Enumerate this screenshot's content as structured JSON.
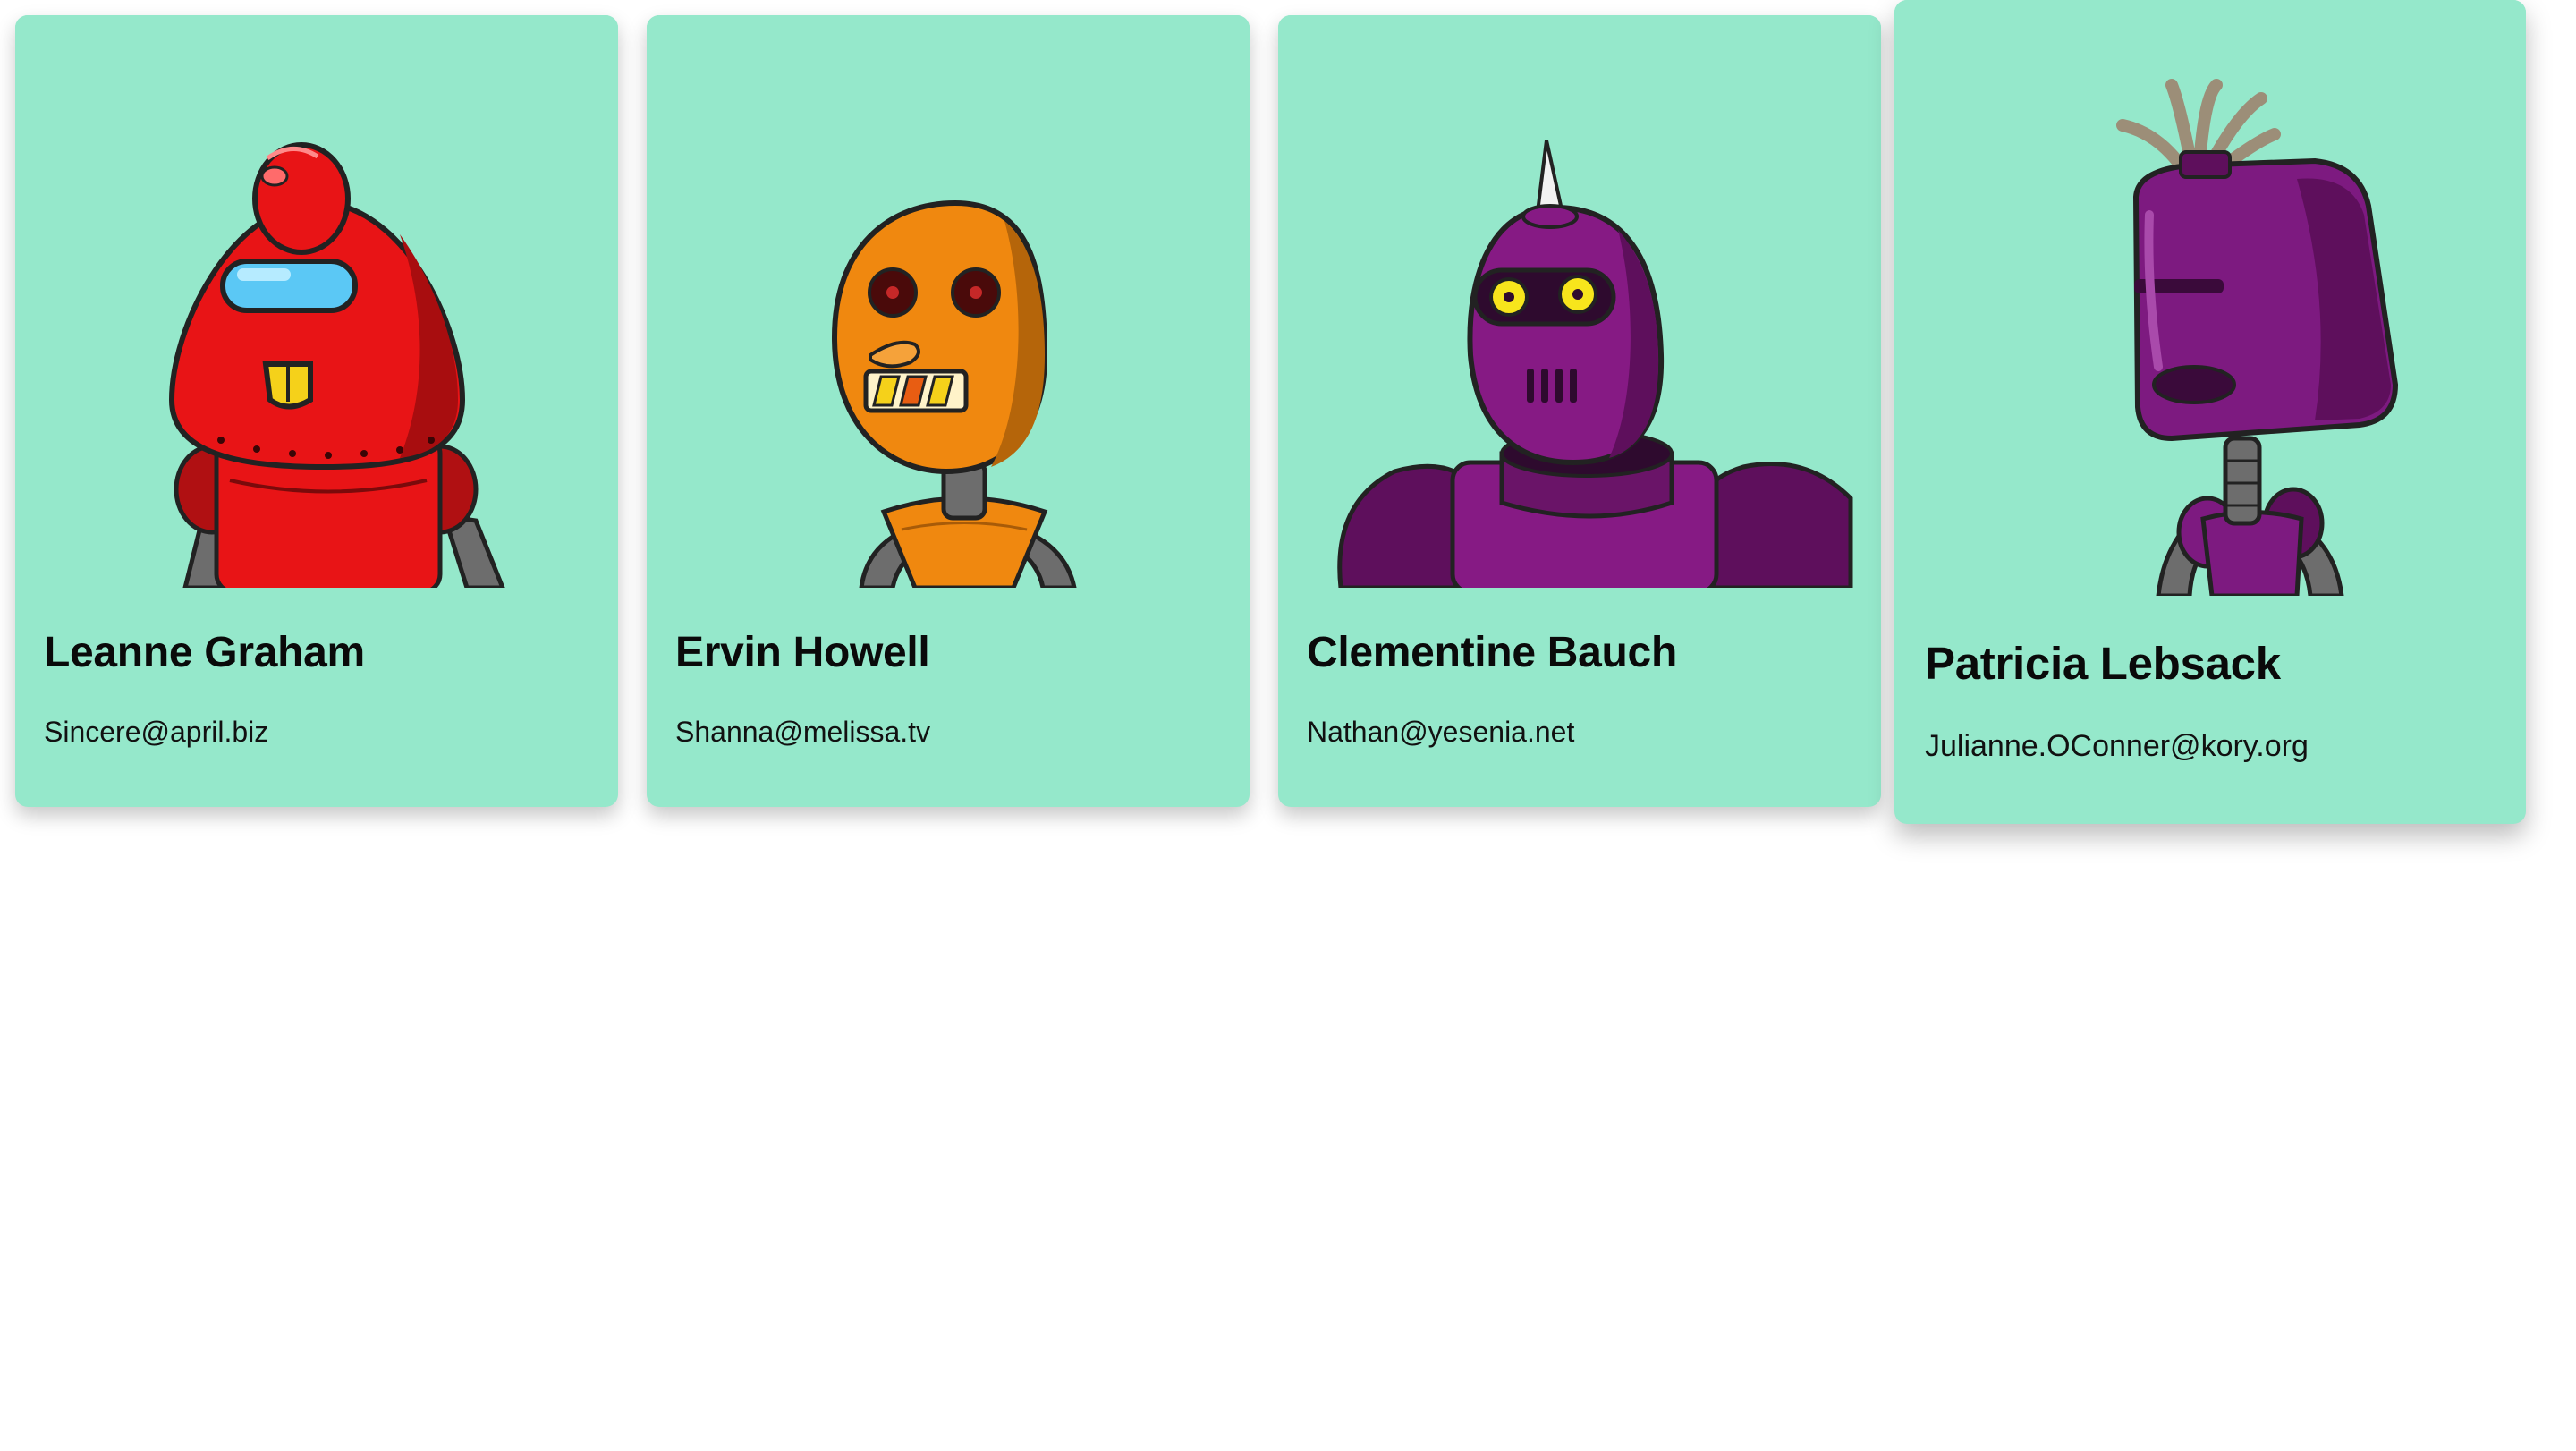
{
  "theme": {
    "card_background": "#95e8cb",
    "name_color": "#0a0a0a",
    "email_color": "#111111"
  },
  "users": [
    {
      "name": "Leanne Graham",
      "email": "Sincere@april.biz",
      "avatar_icon": "red-robot-avatar",
      "robot_color": "#e81416"
    },
    {
      "name": "Ervin Howell",
      "email": "Shanna@melissa.tv",
      "avatar_icon": "orange-robot-avatar",
      "robot_color": "#f0880f"
    },
    {
      "name": "Clementine Bauch",
      "email": "Nathan@yesenia.net",
      "avatar_icon": "purple-robot-avatar",
      "robot_color": "#861a84"
    },
    {
      "name": "Patricia Lebsack",
      "email": "Julianne.OConner@kory.org",
      "avatar_icon": "purple-robot-avatar",
      "robot_color": "#7d1a80"
    }
  ]
}
